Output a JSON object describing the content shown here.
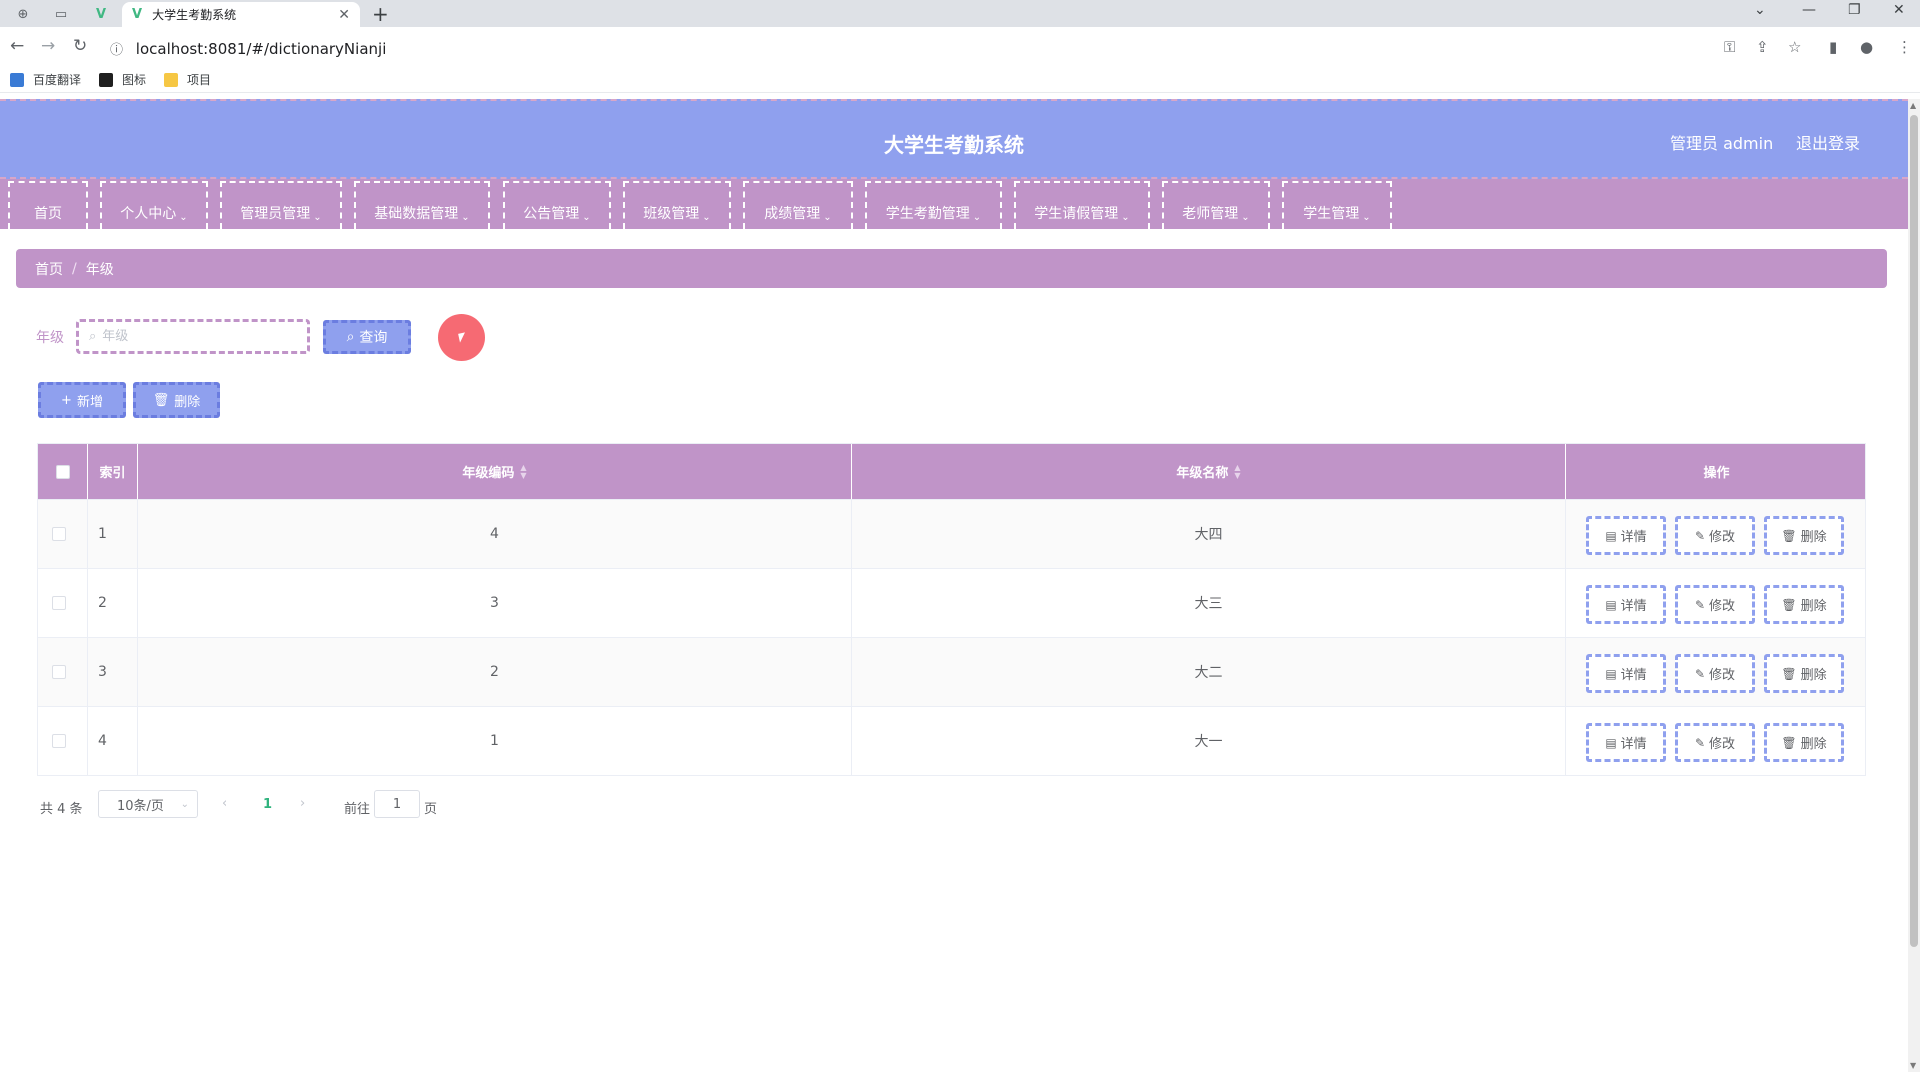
{
  "browser": {
    "tab_title": "大学生考勤系统",
    "url": "localhost:8081/#/dictionaryNianji",
    "bookmarks": [
      "百度翻译",
      "图标",
      "项目"
    ]
  },
  "header": {
    "title": "大学生考勤系统",
    "user": "管理员 admin",
    "logout": "退出登录"
  },
  "menu": [
    {
      "label": "首页",
      "has_arrow": false
    },
    {
      "label": "个人中心",
      "has_arrow": true
    },
    {
      "label": "管理员管理",
      "has_arrow": true
    },
    {
      "label": "基础数据管理",
      "has_arrow": true
    },
    {
      "label": "公告管理",
      "has_arrow": true
    },
    {
      "label": "班级管理",
      "has_arrow": true
    },
    {
      "label": "成绩管理",
      "has_arrow": true
    },
    {
      "label": "学生考勤管理",
      "has_arrow": true
    },
    {
      "label": "学生请假管理",
      "has_arrow": true
    },
    {
      "label": "老师管理",
      "has_arrow": true
    },
    {
      "label": "学生管理",
      "has_arrow": true
    }
  ],
  "breadcrumb": {
    "home": "首页",
    "current": "年级"
  },
  "search": {
    "label": "年级",
    "placeholder": "年级",
    "query_button": "查询"
  },
  "actions": {
    "add": "新增",
    "delete": "删除"
  },
  "table": {
    "columns": {
      "index": "索引",
      "code": "年级编码",
      "name": "年级名称",
      "ops": "操作"
    },
    "rows": [
      {
        "index": "1",
        "code": "4",
        "name": "大四"
      },
      {
        "index": "2",
        "code": "3",
        "name": "大三"
      },
      {
        "index": "3",
        "code": "2",
        "name": "大二"
      },
      {
        "index": "4",
        "code": "1",
        "name": "大一"
      }
    ],
    "row_actions": {
      "detail": "详情",
      "edit": "修改",
      "delete": "删除"
    }
  },
  "pagination": {
    "total": "共 4 条",
    "page_size": "10条/页",
    "current_page": "1",
    "goto_prefix": "前往",
    "goto_value": "1",
    "goto_suffix": "页"
  },
  "colors": {
    "header": "#8fa0ee",
    "menu": "#c094c8",
    "accent_green": "#2fb37d"
  }
}
